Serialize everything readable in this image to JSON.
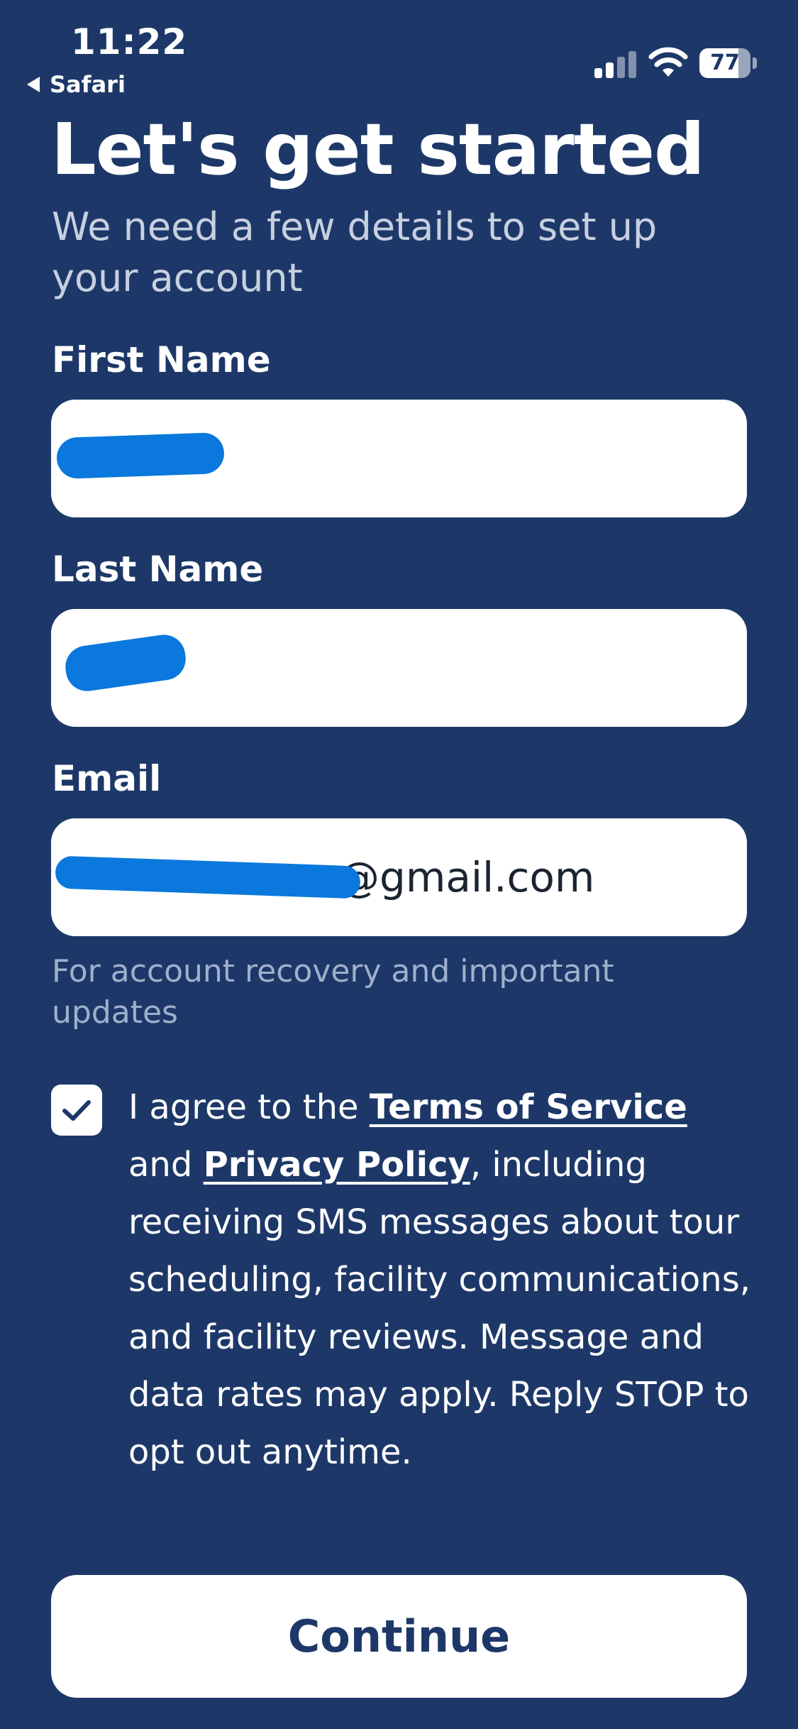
{
  "status_bar": {
    "time": "11:22",
    "back_app": "Safari",
    "battery_level": "77",
    "battery_fraction": 0.77
  },
  "header": {
    "title": "Let's get started",
    "subtitle": "We need a few details to set up your account"
  },
  "form": {
    "first_name": {
      "label": "First Name",
      "value": ""
    },
    "last_name": {
      "label": "Last Name",
      "value": ""
    },
    "email": {
      "label": "Email",
      "value_visible_suffix": "@gmail.com",
      "helper": "For account recovery and important updates"
    },
    "consent": {
      "checked": true,
      "text_before": "I agree to the ",
      "terms_link": "Terms of Service",
      "text_middle": " and ",
      "privacy_link": "Privacy Policy",
      "text_after": ", including receiving SMS messages about tour scheduling, facility communications, and facility reviews. Message and data rates may apply. Reply STOP to opt out anytime."
    }
  },
  "actions": {
    "continue_label": "Continue"
  },
  "colors": {
    "background": "#1d3868",
    "redaction": "#0a78dc",
    "button_text": "#1d3868"
  },
  "icons": {
    "signal": "cellular-signal-icon",
    "wifi": "wifi-icon",
    "battery": "battery-icon",
    "back": "back-arrow-icon",
    "check": "checkmark-icon"
  }
}
